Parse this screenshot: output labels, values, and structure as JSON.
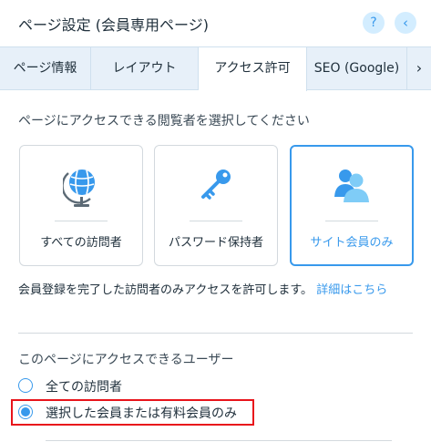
{
  "header": {
    "title": "ページ設定 (会員専用ページ)",
    "help_icon": "question-mark-icon",
    "help_glyph": "?",
    "back_icon": "chevron-left-icon",
    "back_glyph": "‹"
  },
  "tabs": [
    {
      "label": "ページ情報",
      "active": false
    },
    {
      "label": "レイアウト",
      "active": false
    },
    {
      "label": "アクセス許可",
      "active": true
    },
    {
      "label": "SEO (Google)",
      "active": false
    }
  ],
  "tabs_more_glyph": "›",
  "permissions": {
    "section_label": "ページにアクセスできる閲覧者を選択してください",
    "cards": [
      {
        "label": "すべての訪問者",
        "icon": "globe-icon",
        "selected": false
      },
      {
        "label": "パスワード保持者",
        "icon": "key-icon",
        "selected": false
      },
      {
        "label": "サイト会員のみ",
        "icon": "members-icon",
        "selected": true
      }
    ],
    "description": "会員登録を完了した訪問者のみアクセスを許可します。",
    "details_link": "詳細はこちら"
  },
  "access_users": {
    "label": "このページにアクセスできるユーザー",
    "options": [
      {
        "label": "全ての訪問者",
        "checked": false
      },
      {
        "label": "選択した会員または有料会員のみ",
        "checked": true
      }
    ]
  },
  "colors": {
    "accent": "#3899ec",
    "tab_bg": "#e7f0f9",
    "highlight": "#e8141b"
  }
}
